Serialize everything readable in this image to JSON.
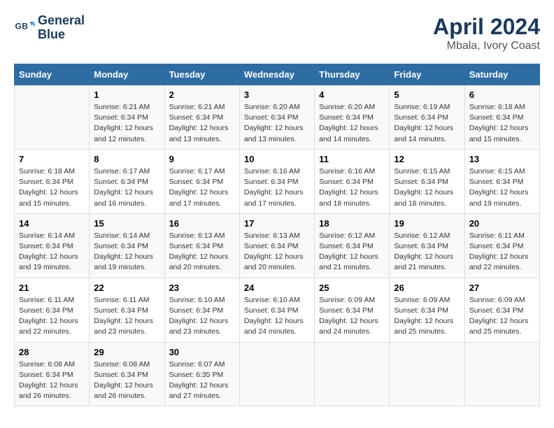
{
  "header": {
    "logo_line1": "General",
    "logo_line2": "Blue",
    "month": "April 2024",
    "location": "Mbala, Ivory Coast"
  },
  "days_of_week": [
    "Sunday",
    "Monday",
    "Tuesday",
    "Wednesday",
    "Thursday",
    "Friday",
    "Saturday"
  ],
  "weeks": [
    [
      {
        "day": "",
        "sunrise": "",
        "sunset": "",
        "daylight": ""
      },
      {
        "day": "1",
        "sunrise": "Sunrise: 6:21 AM",
        "sunset": "Sunset: 6:34 PM",
        "daylight": "Daylight: 12 hours and 12 minutes."
      },
      {
        "day": "2",
        "sunrise": "Sunrise: 6:21 AM",
        "sunset": "Sunset: 6:34 PM",
        "daylight": "Daylight: 12 hours and 13 minutes."
      },
      {
        "day": "3",
        "sunrise": "Sunrise: 6:20 AM",
        "sunset": "Sunset: 6:34 PM",
        "daylight": "Daylight: 12 hours and 13 minutes."
      },
      {
        "day": "4",
        "sunrise": "Sunrise: 6:20 AM",
        "sunset": "Sunset: 6:34 PM",
        "daylight": "Daylight: 12 hours and 14 minutes."
      },
      {
        "day": "5",
        "sunrise": "Sunrise: 6:19 AM",
        "sunset": "Sunset: 6:34 PM",
        "daylight": "Daylight: 12 hours and 14 minutes."
      },
      {
        "day": "6",
        "sunrise": "Sunrise: 6:18 AM",
        "sunset": "Sunset: 6:34 PM",
        "daylight": "Daylight: 12 hours and 15 minutes."
      }
    ],
    [
      {
        "day": "7",
        "sunrise": "Sunrise: 6:18 AM",
        "sunset": "Sunset: 6:34 PM",
        "daylight": "Daylight: 12 hours and 15 minutes."
      },
      {
        "day": "8",
        "sunrise": "Sunrise: 6:17 AM",
        "sunset": "Sunset: 6:34 PM",
        "daylight": "Daylight: 12 hours and 16 minutes."
      },
      {
        "day": "9",
        "sunrise": "Sunrise: 6:17 AM",
        "sunset": "Sunset: 6:34 PM",
        "daylight": "Daylight: 12 hours and 17 minutes."
      },
      {
        "day": "10",
        "sunrise": "Sunrise: 6:16 AM",
        "sunset": "Sunset: 6:34 PM",
        "daylight": "Daylight: 12 hours and 17 minutes."
      },
      {
        "day": "11",
        "sunrise": "Sunrise: 6:16 AM",
        "sunset": "Sunset: 6:34 PM",
        "daylight": "Daylight: 12 hours and 18 minutes."
      },
      {
        "day": "12",
        "sunrise": "Sunrise: 6:15 AM",
        "sunset": "Sunset: 6:34 PM",
        "daylight": "Daylight: 12 hours and 18 minutes."
      },
      {
        "day": "13",
        "sunrise": "Sunrise: 6:15 AM",
        "sunset": "Sunset: 6:34 PM",
        "daylight": "Daylight: 12 hours and 19 minutes."
      }
    ],
    [
      {
        "day": "14",
        "sunrise": "Sunrise: 6:14 AM",
        "sunset": "Sunset: 6:34 PM",
        "daylight": "Daylight: 12 hours and 19 minutes."
      },
      {
        "day": "15",
        "sunrise": "Sunrise: 6:14 AM",
        "sunset": "Sunset: 6:34 PM",
        "daylight": "Daylight: 12 hours and 19 minutes."
      },
      {
        "day": "16",
        "sunrise": "Sunrise: 6:13 AM",
        "sunset": "Sunset: 6:34 PM",
        "daylight": "Daylight: 12 hours and 20 minutes."
      },
      {
        "day": "17",
        "sunrise": "Sunrise: 6:13 AM",
        "sunset": "Sunset: 6:34 PM",
        "daylight": "Daylight: 12 hours and 20 minutes."
      },
      {
        "day": "18",
        "sunrise": "Sunrise: 6:12 AM",
        "sunset": "Sunset: 6:34 PM",
        "daylight": "Daylight: 12 hours and 21 minutes."
      },
      {
        "day": "19",
        "sunrise": "Sunrise: 6:12 AM",
        "sunset": "Sunset: 6:34 PM",
        "daylight": "Daylight: 12 hours and 21 minutes."
      },
      {
        "day": "20",
        "sunrise": "Sunrise: 6:11 AM",
        "sunset": "Sunset: 6:34 PM",
        "daylight": "Daylight: 12 hours and 22 minutes."
      }
    ],
    [
      {
        "day": "21",
        "sunrise": "Sunrise: 6:11 AM",
        "sunset": "Sunset: 6:34 PM",
        "daylight": "Daylight: 12 hours and 22 minutes."
      },
      {
        "day": "22",
        "sunrise": "Sunrise: 6:11 AM",
        "sunset": "Sunset: 6:34 PM",
        "daylight": "Daylight: 12 hours and 23 minutes."
      },
      {
        "day": "23",
        "sunrise": "Sunrise: 6:10 AM",
        "sunset": "Sunset: 6:34 PM",
        "daylight": "Daylight: 12 hours and 23 minutes."
      },
      {
        "day": "24",
        "sunrise": "Sunrise: 6:10 AM",
        "sunset": "Sunset: 6:34 PM",
        "daylight": "Daylight: 12 hours and 24 minutes."
      },
      {
        "day": "25",
        "sunrise": "Sunrise: 6:09 AM",
        "sunset": "Sunset: 6:34 PM",
        "daylight": "Daylight: 12 hours and 24 minutes."
      },
      {
        "day": "26",
        "sunrise": "Sunrise: 6:09 AM",
        "sunset": "Sunset: 6:34 PM",
        "daylight": "Daylight: 12 hours and 25 minutes."
      },
      {
        "day": "27",
        "sunrise": "Sunrise: 6:09 AM",
        "sunset": "Sunset: 6:34 PM",
        "daylight": "Daylight: 12 hours and 25 minutes."
      }
    ],
    [
      {
        "day": "28",
        "sunrise": "Sunrise: 6:08 AM",
        "sunset": "Sunset: 6:34 PM",
        "daylight": "Daylight: 12 hours and 26 minutes."
      },
      {
        "day": "29",
        "sunrise": "Sunrise: 6:08 AM",
        "sunset": "Sunset: 6:34 PM",
        "daylight": "Daylight: 12 hours and 26 minutes."
      },
      {
        "day": "30",
        "sunrise": "Sunrise: 6:07 AM",
        "sunset": "Sunset: 6:35 PM",
        "daylight": "Daylight: 12 hours and 27 minutes."
      },
      {
        "day": "",
        "sunrise": "",
        "sunset": "",
        "daylight": ""
      },
      {
        "day": "",
        "sunrise": "",
        "sunset": "",
        "daylight": ""
      },
      {
        "day": "",
        "sunrise": "",
        "sunset": "",
        "daylight": ""
      },
      {
        "day": "",
        "sunrise": "",
        "sunset": "",
        "daylight": ""
      }
    ]
  ]
}
